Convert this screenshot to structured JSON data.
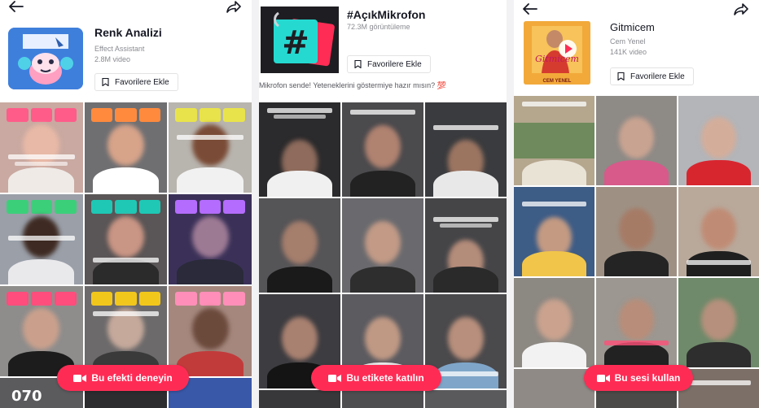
{
  "colors": {
    "accent": "#fe2c55",
    "text_primary": "#161823",
    "text_secondary": "#8a8b91"
  },
  "icons": {
    "back": "arrow-left-icon",
    "share": "share-arrow-icon",
    "bookmark": "bookmark-icon",
    "camera": "video-camera-icon"
  },
  "effect_page": {
    "title": "Renk Analizi",
    "creator": "Effect Assistant",
    "video_count": "2.8M video",
    "favorite_label": "Favorilere Ekle",
    "cta_label": "Bu efekti deneyin",
    "grid_caption_number": "070"
  },
  "hashtag_page": {
    "title": "#AçıkMikrofon",
    "views": "72.3M görüntüleme",
    "favorite_label": "Favorilere Ekle",
    "description": "Mikrofon sende! Yeteneklerini göstermiye hazır mısın? 💯",
    "cta_label": "Bu etikete katılın"
  },
  "sound_page": {
    "title": "Gitmicem",
    "artist": "Cem Yenel",
    "video_count": "141K video",
    "favorite_label": "Favorilere Ekle",
    "cta_label": "Bu sesi kullan",
    "cover_artist_text": "CEM YENEL",
    "cover_title_text": "Gitmicem"
  }
}
